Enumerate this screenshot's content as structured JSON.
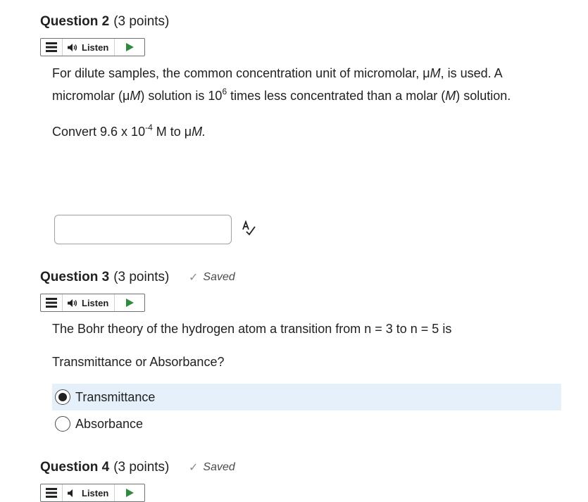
{
  "q2": {
    "number": "Question 2",
    "points": "(3 points)",
    "listen_label": "Listen",
    "p1_a": "For dilute samples, the common concentration unit of micromolar, μ",
    "p1_b": "M",
    "p1_c": ", is used. A",
    "p2_a": "micromolar (μ",
    "p2_b": "M",
    "p2_c": ") solution is 10",
    "p2_sup": "6",
    "p2_d": " times less concentrated than a molar (",
    "p2_e": "M",
    "p2_f": ") solution.",
    "p3_a": "Convert 9.6 x 10",
    "p3_sup": "-4",
    "p3_b": " M to μ",
    "p3_c": "M.",
    "answer_value": ""
  },
  "q3": {
    "number": "Question 3",
    "points": "(3 points)",
    "saved": "Saved",
    "listen_label": "Listen",
    "prompt": "The Bohr theory of the hydrogen atom a transition from n = 3 to n = 5 is",
    "sub_prompt": "Transmittance or Absorbance?",
    "options": [
      {
        "label": "Transmittance",
        "selected": true
      },
      {
        "label": "Absorbance",
        "selected": false
      }
    ]
  },
  "q4": {
    "number": "Question 4",
    "points": "(3 points)",
    "saved": "Saved",
    "listen_label": "Listen"
  },
  "colors": {
    "play": "#2e8b3d",
    "selected_bg": "#e6f0fa"
  },
  "icons": [
    "menu-icon",
    "speaker-icon",
    "play-icon",
    "spellcheck-icon",
    "checkmark-icon"
  ]
}
